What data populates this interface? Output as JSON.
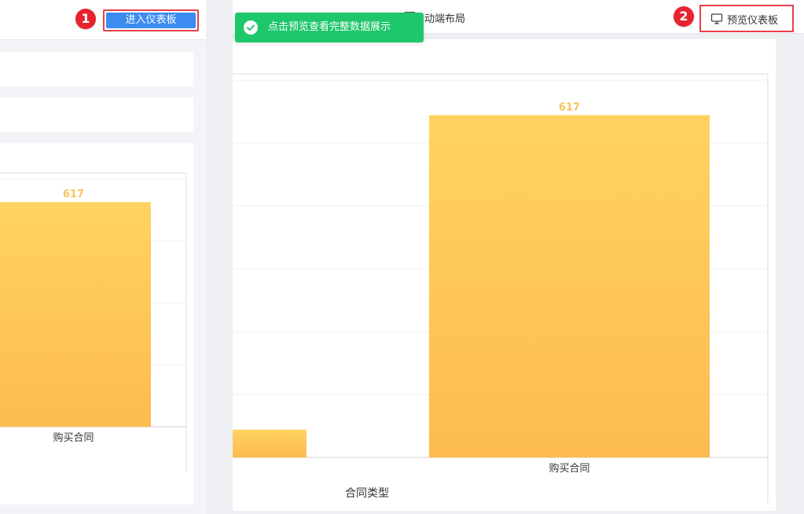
{
  "left_pane": {
    "enter_button_label": "进入仪表板",
    "callout_1": "1",
    "chart_data": {
      "type": "bar",
      "categories": [
        "购买合同"
      ],
      "values": [
        617
      ],
      "ylim": [
        0,
        680
      ],
      "data_labels": true
    }
  },
  "right_pane": {
    "toast_text": "点击预览查看完整数据展示",
    "mobile_layout_label": "移动端布局",
    "preview_button_label": "预览仪表板",
    "callout_2": "2",
    "chart_data": {
      "type": "bar",
      "categories": [
        "",
        "购买合同"
      ],
      "values": [
        50,
        617
      ],
      "xlabel": "合同类型",
      "ylim": [
        0,
        680
      ],
      "data_labels": true
    }
  },
  "colors": {
    "bar_top": "#ffd362",
    "bar_bottom": "#fdbb4f",
    "value_label": "#f7c35a",
    "button_blue": "#3c8bf0",
    "callout_red": "#e8232f",
    "toast_green": "#1ec76a"
  },
  "icons": {
    "toast": "check-circle-icon",
    "preview": "monitor-icon"
  }
}
